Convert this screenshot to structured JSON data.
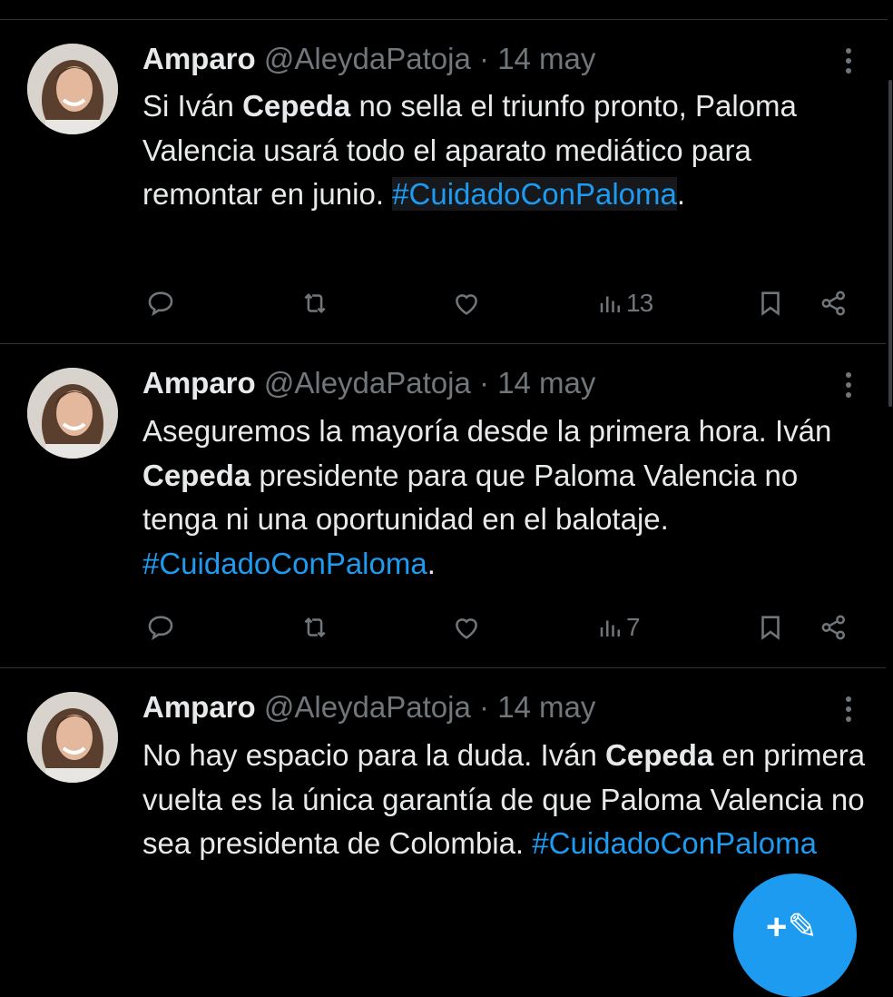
{
  "colors": {
    "background": "#000000",
    "text": "#e7e9ea",
    "muted": "#71767b",
    "accent": "#1d9bf0",
    "divider": "#2f3336"
  },
  "tweets": [
    {
      "author": "Amparo",
      "handle": "@AleydaPatoja",
      "separator": "·",
      "date": "14 may",
      "text_parts": [
        "Si Iván ",
        "Cepeda",
        " no sella el triunfo pronto, Paloma Valencia usará todo el aparato mediático para remontar en junio. ",
        "#CuidadoConPaloma",
        "."
      ],
      "views": "13"
    },
    {
      "author": "Amparo",
      "handle": "@AleydaPatoja",
      "separator": "·",
      "date": "14 may",
      "text_parts": [
        "Aseguremos la mayoría desde la primera hora. Iván ",
        "Cepeda",
        " presidente para que Paloma Valencia no tenga ni una oportunidad en el balotaje. ",
        "#CuidadoConPaloma",
        "."
      ],
      "views": "7"
    },
    {
      "author": "Amparo",
      "handle": "@AleydaPatoja",
      "separator": "·",
      "date": "14 may",
      "text_parts": [
        "No hay espacio para la duda. Iván ",
        "Cepeda",
        " en primera vuelta es la única garantía de que Paloma Valencia no sea presidenta de Colombia. ",
        "#CuidadoConPaloma",
        ""
      ],
      "views": ""
    }
  ],
  "icons": {
    "reply": "reply-icon",
    "retweet": "retweet-icon",
    "like": "like-icon",
    "views": "views-icon",
    "bookmark": "bookmark-icon",
    "share": "share-icon",
    "more": "more-icon",
    "compose": "compose-icon"
  }
}
